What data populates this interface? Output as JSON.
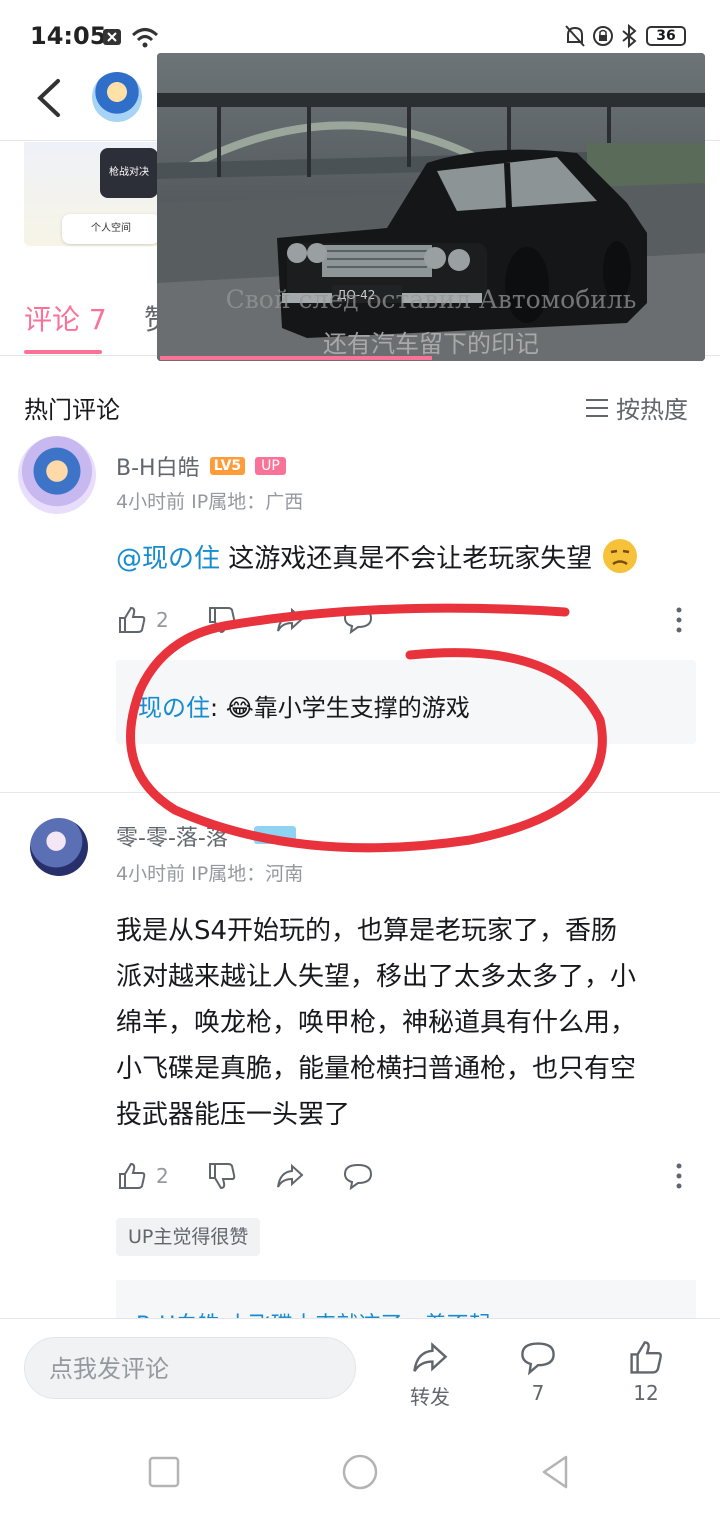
{
  "status_bar": {
    "time": "14:05",
    "battery": "36"
  },
  "background_thumb": {
    "button1": "枪战对决",
    "button2": "个人空间"
  },
  "tabs": {
    "comments": "评论 7",
    "other": "赞"
  },
  "video": {
    "subtitle_ru": "Свой след оставил Автомобиль",
    "subtitle_zh": "还有汽车留下的印记",
    "plate": "ДО-42"
  },
  "hot_comments": {
    "title": "热门评论",
    "sort_label": "按热度",
    "comments": [
      {
        "username": "B-H白皓",
        "level": "LV5",
        "badge": "UP",
        "meta": "4小时前  IP属地：广西",
        "mention": "@现の住",
        "text": " 这游戏还真是不会让老玩家失望",
        "likes": "2",
        "reply": {
          "name": "现の住",
          "text": ": 😂靠小学生支撑的游戏"
        }
      },
      {
        "username": "零-零-落-落",
        "meta": "4小时前  IP属地：河南",
        "text_lines": [
          "我是从S4开始玩的，也算是老玩家了，香肠",
          "派对越来越让人失望，移出了太多太多了，小",
          "绵羊，唤龙枪，唤甲枪，神秘道具有什么用，",
          "小飞碟是真脆，能量枪横扫普通枪，也只有空",
          "投武器能压一头罢了"
        ],
        "likes": "2",
        "up_liked": "UP主觉得很赞",
        "reply_preview": "B-H白皓  小飞碟本来就这了，着不起"
      }
    ]
  },
  "bottom_bar": {
    "input_placeholder": "点我发评论",
    "share_label": "转发",
    "comment_count": "7",
    "like_count": "12"
  },
  "colors": {
    "accent": "#fb7299",
    "link": "#178bcf",
    "annotation": "#e8323c"
  }
}
